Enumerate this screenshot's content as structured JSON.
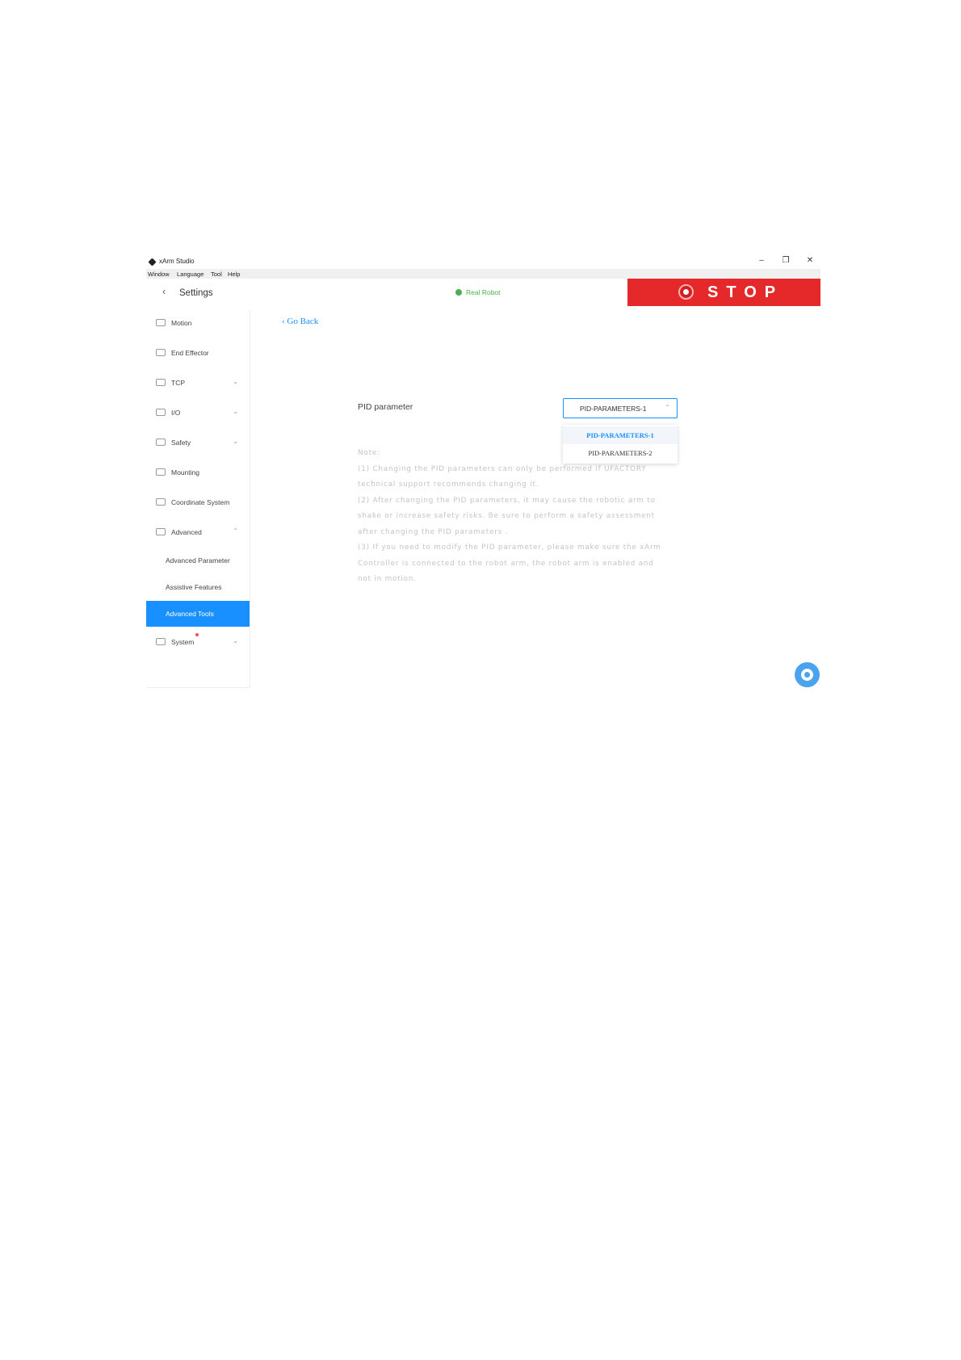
{
  "window": {
    "title": "xArm Studio",
    "controls": {
      "minimize": "–",
      "maximize": "❐",
      "close": "✕"
    }
  },
  "menu": [
    "Window",
    "Language",
    "Tool",
    "Help"
  ],
  "header": {
    "back_icon": "‹",
    "title": "Settings",
    "status": "Real Robot",
    "stop_label": "STOP"
  },
  "sidebar": {
    "items": [
      {
        "label": "Motion",
        "icon": "motion-icon"
      },
      {
        "label": "End Effector",
        "icon": "end-effector-icon"
      },
      {
        "label": "TCP",
        "icon": "tcp-icon",
        "caret": "⌄"
      },
      {
        "label": "I/O",
        "icon": "io-icon",
        "caret": "⌄"
      },
      {
        "label": "Safety",
        "icon": "safety-icon",
        "caret": "⌄"
      },
      {
        "label": "Mounting",
        "icon": "mounting-icon"
      },
      {
        "label": "Coordinate System",
        "icon": "coordinate-icon"
      },
      {
        "label": "Advanced",
        "icon": "advanced-icon",
        "caret": "⌃"
      }
    ],
    "sub_items": [
      "Advanced Parameter",
      "Assistive Features",
      "Advanced Tools"
    ],
    "active_sub": "Advanced Tools",
    "system": {
      "label": "System",
      "caret": "⌄"
    }
  },
  "main": {
    "go_back": "Go Back",
    "pid_label": "PID parameter",
    "select_value": "PID-PARAMETERS-1",
    "select_arrow": "⌃",
    "options": [
      "PID-PARAMETERS-1",
      "PID-PARAMETERS-2"
    ],
    "note_lines": [
      "Note:",
      "(1) Changing the PID parameters can only be performed if UFACTORY",
      "technical support recommends changing it.",
      "(2) After changing the PID parameters, it may cause the robotic arm to",
      "shake or increase safety risks. Be sure to perform a safety assessment",
      "after changing the PID parameters .",
      "(3) If you need to modify the PID parameter, please make sure the xArm",
      "Controller is connected to the robot arm, the robot arm is enabled and",
      "not in motion."
    ]
  },
  "colors": {
    "accent": "#1890ff",
    "stop": "#e5292b",
    "status": "#4caf50"
  }
}
